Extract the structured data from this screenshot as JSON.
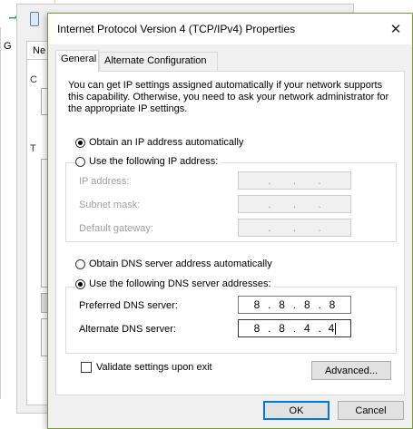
{
  "background": {
    "window1_label": "G",
    "window2_tab_label": "Ne",
    "window2_letter_c": "C",
    "window2_letter_t": "T"
  },
  "dialog": {
    "title": "Internet Protocol Version 4 (TCP/IPv4) Properties",
    "close_glyph": "✕",
    "accent_color": "#7a9a3a"
  },
  "tabs": [
    {
      "label": "General",
      "active": true
    },
    {
      "label": "Alternate Configuration",
      "active": false
    }
  ],
  "general": {
    "intro": "You can get IP settings assigned automatically if your network supports this capability. Otherwise, you need to ask your network administrator for the appropriate IP settings.",
    "ip_auto_label": "Obtain an IP address automatically",
    "ip_manual_label": "Use the following IP address:",
    "ip_mode": "auto",
    "ip_fields": [
      {
        "label": "IP address:",
        "value": [
          "",
          "",
          "",
          ""
        ]
      },
      {
        "label": "Subnet mask:",
        "value": [
          "",
          "",
          "",
          ""
        ]
      },
      {
        "label": "Default gateway:",
        "value": [
          "",
          "",
          "",
          ""
        ]
      }
    ],
    "dns_auto_label": "Obtain DNS server address automatically",
    "dns_manual_label": "Use the following DNS server addresses:",
    "dns_mode": "manual",
    "dns_fields": [
      {
        "label": "Preferred DNS server:",
        "value": [
          "8",
          "8",
          "8",
          "8"
        ]
      },
      {
        "label": "Alternate DNS server:",
        "value": [
          "8",
          "8",
          "4",
          "4"
        ]
      }
    ],
    "validate_label": "Validate settings upon exit",
    "validate_checked": false,
    "advanced_label": "Advanced..."
  },
  "footer": {
    "ok_label": "OK",
    "cancel_label": "Cancel"
  },
  "icons": {
    "signal": "signal-bars-icon",
    "network_adapter": "network-adapter-icon",
    "close": "close-icon"
  }
}
